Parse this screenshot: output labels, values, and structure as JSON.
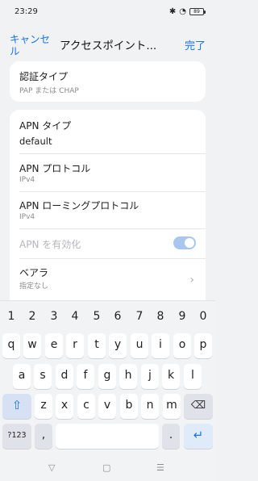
{
  "status": {
    "time": "23:29",
    "bt": "✱",
    "wifi": "◔",
    "battery": "89"
  },
  "nav": {
    "cancel": "キャンセル",
    "title": "アクセスポイント...",
    "done": "完了"
  },
  "auth": {
    "title": "認証タイプ",
    "value": "PAP または CHAP"
  },
  "apn_type": {
    "title": "APN タイプ",
    "value": "default"
  },
  "apn_protocol": {
    "title": "APN プロトコル",
    "value": "IPv4"
  },
  "apn_roaming": {
    "title": "APN ローミングプロトコル",
    "value": "IPv4"
  },
  "apn_enable": {
    "title": "APN を有効化",
    "enabled": true
  },
  "bearer": {
    "title": "ベアラ",
    "value": "指定なし"
  },
  "keyboard": {
    "numbers": [
      "1",
      "2",
      "3",
      "4",
      "5",
      "6",
      "7",
      "8",
      "9",
      "0"
    ],
    "row1": [
      "q",
      "w",
      "e",
      "r",
      "t",
      "y",
      "u",
      "i",
      "o",
      "p"
    ],
    "row2": [
      "a",
      "s",
      "d",
      "f",
      "g",
      "h",
      "j",
      "k",
      "l"
    ],
    "row3": [
      "z",
      "x",
      "c",
      "v",
      "b",
      "n",
      "m"
    ],
    "shift": "⇧",
    "backspace": "⌫",
    "symbols": "?123",
    "comma": ",",
    "period": ".",
    "enter": "↵"
  },
  "bottom_nav": {
    "back": "▽",
    "home": "▢",
    "recents": "☰"
  },
  "colors": {
    "accent": "#1a73e8",
    "toggle_track": "#a9c6ef"
  }
}
